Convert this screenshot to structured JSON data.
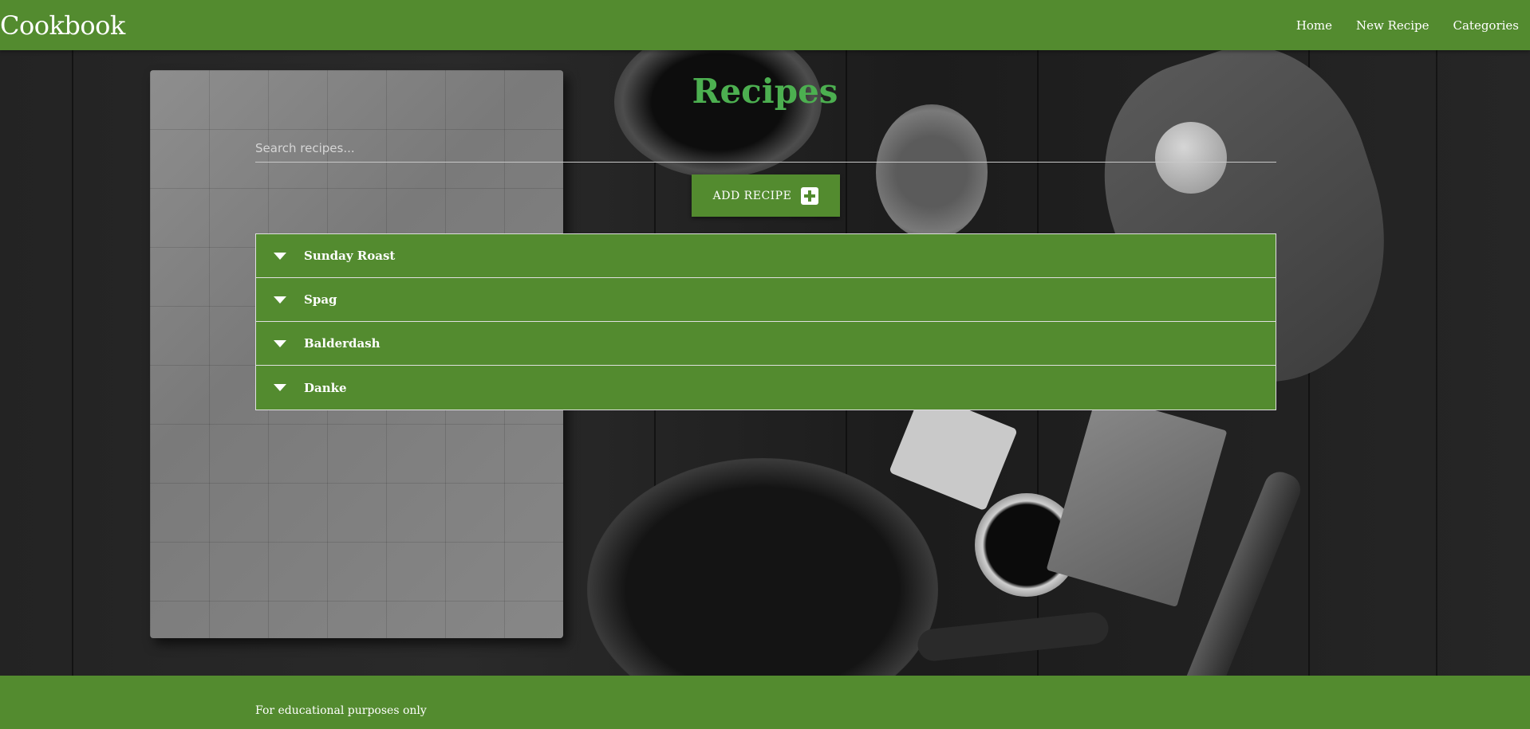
{
  "nav": {
    "brand": "Cookbook",
    "links": [
      "Home",
      "New Recipe",
      "Categories"
    ]
  },
  "main": {
    "title": "Recipes",
    "search": {
      "placeholder": "Search recipes...",
      "value": ""
    },
    "add_button": {
      "label": "ADD RECIPE",
      "icon": "plus-square-icon"
    },
    "recipes": [
      "Sunday Roast",
      "Spag",
      "Balderdash",
      "Danke"
    ]
  },
  "footer": {
    "text": "For educational purposes only"
  },
  "colors": {
    "brand_green": "#538b2f",
    "title_green": "#4caf50"
  }
}
